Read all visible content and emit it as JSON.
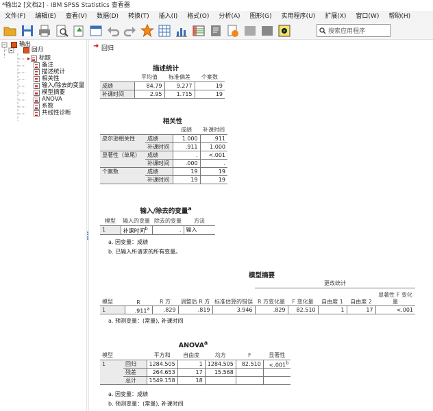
{
  "window": {
    "title": "*输出2 [文档2] - IBM SPSS Statistics 查看器"
  },
  "menu": [
    "文件(F)",
    "编辑(E)",
    "查看(V)",
    "数据(D)",
    "转换(T)",
    "插入(I)",
    "格式(O)",
    "分析(A)",
    "图形(G)",
    "实用程序(U)",
    "扩展(X)",
    "窗口(W)",
    "帮助(H)"
  ],
  "toolbar": {
    "search_placeholder": "搜索应用程序"
  },
  "tree": {
    "root": "输出",
    "group": "回归",
    "items": [
      "标题",
      "备注",
      "描述统计",
      "相关性",
      "输入/除去的变量",
      "模型摘要",
      "ANOVA",
      "系数",
      "共线性诊断"
    ]
  },
  "content": {
    "heading": "回归",
    "desc": {
      "title": "描述统计",
      "headers": [
        "平均值",
        "标准偏差",
        "个案数"
      ],
      "rows": [
        {
          "label": "成绩",
          "vals": [
            "84.79",
            "9.277",
            "19"
          ]
        },
        {
          "label": "补课时间",
          "vals": [
            "2.95",
            "1.715",
            "19"
          ]
        }
      ]
    },
    "corr": {
      "title": "相关性",
      "headers": [
        "成绩",
        "补课时间"
      ],
      "groups": [
        "皮尔逊相关性",
        "显著性（单尾）",
        "个案数"
      ],
      "sublabels": [
        "成绩",
        "补课时间"
      ],
      "values": [
        [
          "1.000",
          ".911"
        ],
        [
          ".911",
          "1.000"
        ],
        [
          ".",
          "<.001"
        ],
        [
          ".000",
          "."
        ],
        [
          "19",
          "19"
        ],
        [
          "19",
          "19"
        ]
      ]
    },
    "entered": {
      "title": "输入/除去的变量",
      "title_sup": "a",
      "headers": [
        "模型",
        "输入的变量",
        "除去的变量",
        "方法"
      ],
      "row": [
        "1",
        "补课时间",
        ".",
        "输入"
      ],
      "row_sup": "b",
      "notes": [
        "a. 因变量：成绩",
        "b. 已输入所请求的所有变量。"
      ]
    },
    "summary": {
      "title": "模型摘要",
      "group_header": "更改统计",
      "headers": [
        "模型",
        "R",
        "R 方",
        "调整后 R 方",
        "标准估算的错误",
        "R 方变化量",
        "F 变化量",
        "自由度 1",
        "自由度 2",
        "显著性 F 变化量"
      ],
      "row": [
        "1",
        ".911",
        ".829",
        ".819",
        "3.946",
        ".829",
        "82.510",
        "1",
        "17",
        "<.001"
      ],
      "r_sup": "a",
      "notes": [
        "a. 预测变量：(常量), 补课时间"
      ]
    },
    "anova": {
      "title": "ANOVA",
      "title_sup": "a",
      "headers": [
        "模型",
        "",
        "平方和",
        "自由度",
        "均方",
        "F",
        "显著性"
      ],
      "model": "1",
      "rows": [
        {
          "label": "回归",
          "vals": [
            "1284.505",
            "1",
            "1284.505",
            "82.510",
            "<.001"
          ]
        },
        {
          "label": "残差",
          "vals": [
            "264.653",
            "17",
            "15.568",
            "",
            ""
          ]
        },
        {
          "label": "总计",
          "vals": [
            "1549.158",
            "18",
            "",
            "",
            ""
          ]
        }
      ],
      "sig_sup": "b",
      "notes": [
        "a. 因变量：成绩",
        "b. 预测变量：(常量), 补课时间"
      ]
    }
  }
}
